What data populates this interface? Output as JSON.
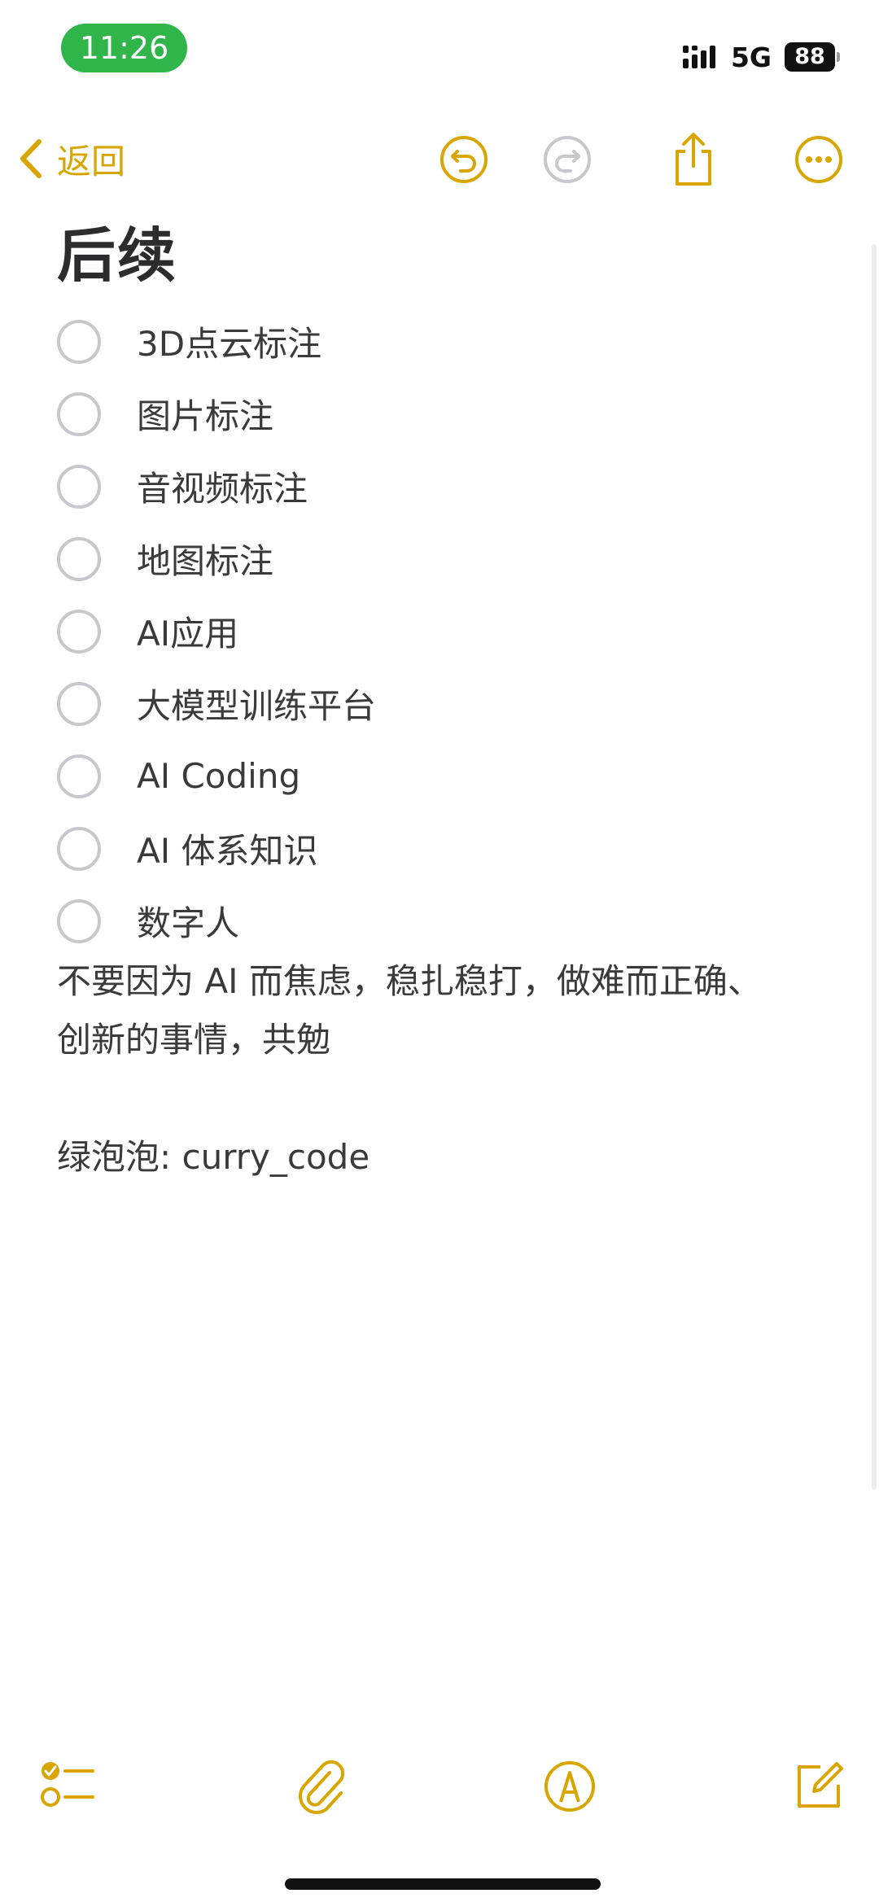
{
  "status_bar": {
    "time": "11:26",
    "network": "5G",
    "battery": "88"
  },
  "nav": {
    "back_label": "返回"
  },
  "note": {
    "title": "后续",
    "checklist": [
      "3D点云标注",
      "图片标注",
      "音视频标注",
      "地图标注",
      "AI应用",
      "大模型训练平台",
      "AI Coding",
      "AI 体系知识",
      "数字人"
    ],
    "paragraph_line1": "不要因为 AI 而焦虑，稳扎稳打，做难而正确、",
    "paragraph_line2": "创新的事情，共勉",
    "contact": "绿泡泡: curry_code"
  },
  "colors": {
    "accent": "#d9a500",
    "time_pill": "#2fb54a",
    "text": "#3a3a3c",
    "checkbox": "#c8c8cc"
  },
  "icons": {
    "nav": [
      "chevron-left-icon",
      "undo-icon",
      "redo-icon",
      "share-icon",
      "more-icon"
    ],
    "toolbar": [
      "checklist-icon",
      "paperclip-icon",
      "markup-icon",
      "compose-icon"
    ]
  }
}
